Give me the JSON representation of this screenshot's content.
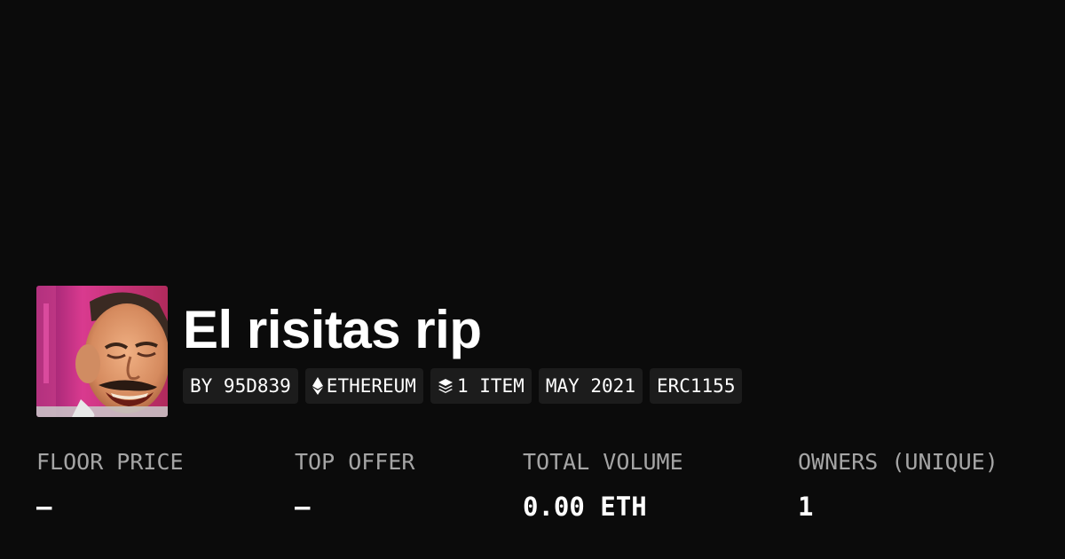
{
  "collection": {
    "title": "El risitas rip",
    "badges": {
      "creator": "BY 95D839",
      "chain": "ETHEREUM",
      "items": "1 ITEM",
      "date": "MAY 2021",
      "standard": "ERC1155"
    }
  },
  "stats": [
    {
      "label": "FLOOR PRICE",
      "value": "–"
    },
    {
      "label": "TOP OFFER",
      "value": "–"
    },
    {
      "label": "TOTAL VOLUME",
      "value": "0.00 ETH"
    },
    {
      "label": "OWNERS (UNIQUE)",
      "value": "1"
    }
  ],
  "icons": {
    "chain": "ethereum-icon",
    "items": "layers-icon"
  },
  "colors": {
    "background": "#0b0b0b",
    "badge_background": "#1c1c1c",
    "label_gray": "#a5a5a5",
    "text": "#ffffff"
  }
}
